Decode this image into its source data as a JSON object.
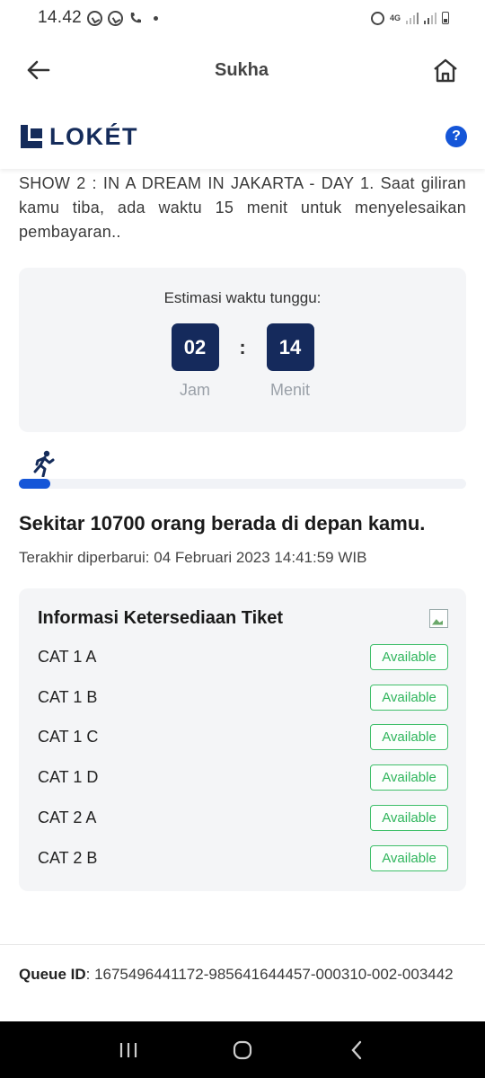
{
  "status_bar": {
    "time": "14.42",
    "network": "4G"
  },
  "app_bar": {
    "title": "Sukha"
  },
  "brand": {
    "logo_text": "LOKÉT",
    "help_label": "?",
    "brand_color": "#152c5b",
    "accent_color": "#1556d8"
  },
  "queue": {
    "message": "SHOW 2 : IN A DREAM IN JAKARTA - DAY 1. Saat giliran kamu tiba, ada waktu 15 menit untuk menyelesaikan pembayaran..",
    "wait_label": "Estimasi waktu tunggu:",
    "hours": "02",
    "hours_unit": "Jam",
    "separator": ":",
    "minutes": "14",
    "minutes_unit": "Menit",
    "progress_fraction": 0.07,
    "people_ahead": "Sekitar 10700 orang berada di depan kamu.",
    "last_updated": "Terakhir diperbarui: 04 Februari 2023 14:41:59 WIB"
  },
  "availability": {
    "title": "Informasi Ketersediaan Tiket",
    "items": [
      {
        "name": "CAT 1 A",
        "status": "Available"
      },
      {
        "name": "CAT 1 B",
        "status": "Available"
      },
      {
        "name": "CAT 1 C",
        "status": "Available"
      },
      {
        "name": "CAT 1 D",
        "status": "Available"
      },
      {
        "name": "CAT 2 A",
        "status": "Available"
      },
      {
        "name": "CAT 2 B",
        "status": "Available"
      }
    ],
    "available_color": "#2fb55c"
  },
  "footer": {
    "queue_id_label": "Queue ID",
    "queue_id_value": ": 1675496441172-985641644457-000310-002-003442"
  }
}
